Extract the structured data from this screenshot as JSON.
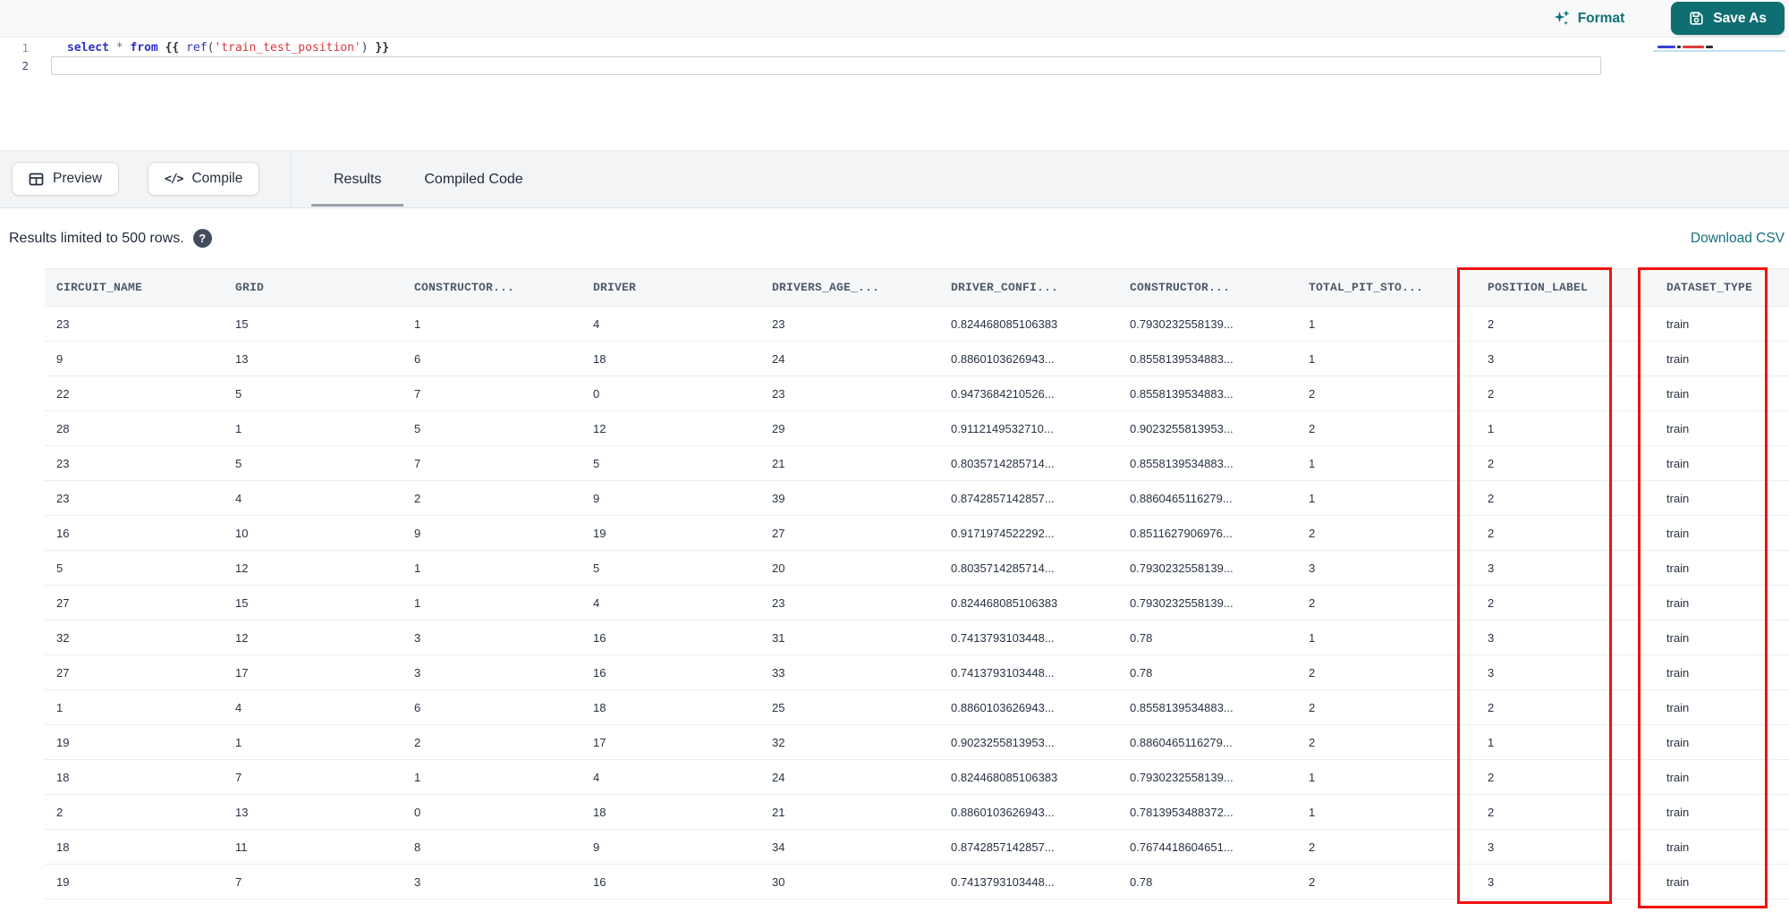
{
  "header": {
    "format_label": "Format",
    "save_as_label": "Save As"
  },
  "editor": {
    "sql": "select * from {{ ref('train_test_position') }}",
    "lines": [
      {
        "number": "1",
        "active": false,
        "tokens": [
          {
            "t": "select",
            "c": "kw"
          },
          {
            "t": " ",
            "c": "pl"
          },
          {
            "t": "*",
            "c": "op"
          },
          {
            "t": " ",
            "c": "pl"
          },
          {
            "t": "from",
            "c": "kw"
          },
          {
            "t": " ",
            "c": "pl"
          },
          {
            "t": "{{",
            "c": "br"
          },
          {
            "t": " ",
            "c": "pl"
          },
          {
            "t": "ref",
            "c": "fn"
          },
          {
            "t": "(",
            "c": "pl"
          },
          {
            "t": "'train_test_position'",
            "c": "str"
          },
          {
            "t": ")",
            "c": "pl"
          },
          {
            "t": " ",
            "c": "pl"
          },
          {
            "t": "}}",
            "c": "br"
          }
        ]
      },
      {
        "number": "2",
        "active": true,
        "tokens": []
      }
    ],
    "minimap_marks": [
      {
        "w": 20,
        "c": "#3a41d6"
      },
      {
        "w": 4,
        "c": "#2b3036"
      },
      {
        "w": 24,
        "c": "#df3a40"
      },
      {
        "w": 8,
        "c": "#2b3036"
      }
    ]
  },
  "toolbar": {
    "preview_label": "Preview",
    "compile_label": "Compile",
    "compile_glyph": "</>",
    "tabs": [
      {
        "label": "Results",
        "active": true
      },
      {
        "label": "Compiled Code",
        "active": false
      }
    ]
  },
  "results": {
    "limit_note": "Results limited to 500 rows.",
    "help_glyph": "?",
    "download_label": "Download CSV"
  },
  "table": {
    "columns": [
      "CIRCUIT_NAME",
      "GRID",
      "CONSTRUCTOR...",
      "DRIVER",
      "DRIVERS_AGE_...",
      "DRIVER_CONFI...",
      "CONSTRUCTOR...",
      "TOTAL_PIT_STO...",
      "POSITION_LABEL",
      "DATASET_TYPE"
    ],
    "highlighted_columns": [
      "POSITION_LABEL",
      "DATASET_TYPE"
    ],
    "rows": [
      [
        "23",
        "15",
        "1",
        "4",
        "23",
        "0.824468085106383",
        "0.7930232558139...",
        "1",
        "2",
        "train"
      ],
      [
        "9",
        "13",
        "6",
        "18",
        "24",
        "0.8860103626943...",
        "0.8558139534883...",
        "1",
        "3",
        "train"
      ],
      [
        "22",
        "5",
        "7",
        "0",
        "23",
        "0.9473684210526...",
        "0.8558139534883...",
        "2",
        "2",
        "train"
      ],
      [
        "28",
        "1",
        "5",
        "12",
        "29",
        "0.9112149532710...",
        "0.9023255813953...",
        "2",
        "1",
        "train"
      ],
      [
        "23",
        "5",
        "7",
        "5",
        "21",
        "0.8035714285714...",
        "0.8558139534883...",
        "1",
        "2",
        "train"
      ],
      [
        "23",
        "4",
        "2",
        "9",
        "39",
        "0.8742857142857...",
        "0.8860465116279...",
        "1",
        "2",
        "train"
      ],
      [
        "16",
        "10",
        "9",
        "19",
        "27",
        "0.9171974522292...",
        "0.8511627906976...",
        "2",
        "2",
        "train"
      ],
      [
        "5",
        "12",
        "1",
        "5",
        "20",
        "0.8035714285714...",
        "0.7930232558139...",
        "3",
        "3",
        "train"
      ],
      [
        "27",
        "15",
        "1",
        "4",
        "23",
        "0.824468085106383",
        "0.7930232558139...",
        "2",
        "2",
        "train"
      ],
      [
        "32",
        "12",
        "3",
        "16",
        "31",
        "0.7413793103448...",
        "0.78",
        "1",
        "3",
        "train"
      ],
      [
        "27",
        "17",
        "3",
        "16",
        "33",
        "0.7413793103448...",
        "0.78",
        "2",
        "3",
        "train"
      ],
      [
        "1",
        "4",
        "6",
        "18",
        "25",
        "0.8860103626943...",
        "0.8558139534883...",
        "2",
        "2",
        "train"
      ],
      [
        "19",
        "1",
        "2",
        "17",
        "32",
        "0.9023255813953...",
        "0.8860465116279...",
        "2",
        "1",
        "train"
      ],
      [
        "18",
        "7",
        "1",
        "4",
        "24",
        "0.824468085106383",
        "0.7930232558139...",
        "1",
        "2",
        "train"
      ],
      [
        "2",
        "13",
        "0",
        "18",
        "21",
        "0.8860103626943...",
        "0.7813953488372...",
        "1",
        "2",
        "train"
      ],
      [
        "18",
        "11",
        "8",
        "9",
        "34",
        "0.8742857142857...",
        "0.7674418604651...",
        "2",
        "3",
        "train"
      ],
      [
        "19",
        "7",
        "3",
        "16",
        "30",
        "0.7413793103448...",
        "0.78",
        "2",
        "3",
        "train"
      ]
    ]
  },
  "colors": {
    "accent_teal": "#0e6e71",
    "link_teal": "#10707d",
    "highlight_red": "#f31111",
    "keyword_blue": "#2b32c8",
    "string_red": "#d6383e"
  }
}
